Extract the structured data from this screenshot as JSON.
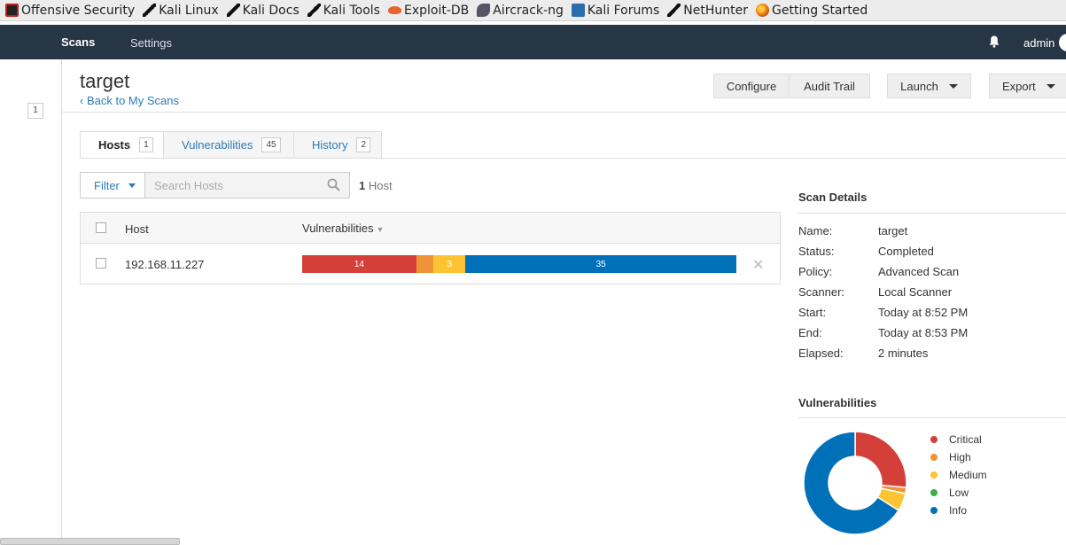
{
  "bookmarks": [
    {
      "label": "Offensive Security",
      "icon": "offsec-icon"
    },
    {
      "label": "Kali Linux",
      "icon": "kali-dragon-icon"
    },
    {
      "label": "Kali Docs",
      "icon": "kali-dragon-icon"
    },
    {
      "label": "Kali Tools",
      "icon": "kali-dragon-icon"
    },
    {
      "label": "Exploit-DB",
      "icon": "exploitdb-icon"
    },
    {
      "label": "Aircrack-ng",
      "icon": "aircrack-icon"
    },
    {
      "label": "Kali Forums",
      "icon": "kali-forums-icon"
    },
    {
      "label": "NetHunter",
      "icon": "kali-dragon-icon"
    },
    {
      "label": "Getting Started",
      "icon": "firefox-icon"
    }
  ],
  "nav": {
    "scans": "Scans",
    "settings": "Settings",
    "user": "admin"
  },
  "sidebar": {
    "count": "1"
  },
  "header": {
    "title": "target",
    "back": "‹ Back to My Scans",
    "configure": "Configure",
    "audit_trail": "Audit Trail",
    "launch": "Launch",
    "export": "Export"
  },
  "tabs": [
    {
      "label": "Hosts",
      "count": "1"
    },
    {
      "label": "Vulnerabilities",
      "count": "45"
    },
    {
      "label": "History",
      "count": "2"
    }
  ],
  "filter": {
    "label": "Filter",
    "placeholder": "Search Hosts",
    "count_num": "1",
    "count_text": "Host"
  },
  "table": {
    "col_host": "Host",
    "col_vulns": "Vulnerabilities",
    "sort_indicator": "▼",
    "rows": [
      {
        "host": "192.168.11.227",
        "critical": 14,
        "high": 1,
        "medium": 3,
        "low": 0,
        "info": 35
      }
    ]
  },
  "scan_details": {
    "title": "Scan Details",
    "rows": [
      {
        "key": "Name:",
        "value": "target"
      },
      {
        "key": "Status:",
        "value": "Completed"
      },
      {
        "key": "Policy:",
        "value": "Advanced Scan"
      },
      {
        "key": "Scanner:",
        "value": "Local Scanner"
      },
      {
        "key": "Start:",
        "value": "Today at 8:52 PM"
      },
      {
        "key": "End:",
        "value": "Today at 8:53 PM"
      },
      {
        "key": "Elapsed:",
        "value": "2 minutes"
      }
    ]
  },
  "vuln_chart": {
    "title": "Vulnerabilities",
    "legend": [
      {
        "label": "Critical",
        "color": "#d43f3a",
        "count": 14
      },
      {
        "label": "High",
        "color": "#ee9336",
        "count": 1
      },
      {
        "label": "Medium",
        "color": "#fdc431",
        "count": 3
      },
      {
        "label": "Low",
        "color": "#3fae49",
        "count": 0
      },
      {
        "label": "Info",
        "color": "#0071b9",
        "count": 35
      }
    ]
  }
}
